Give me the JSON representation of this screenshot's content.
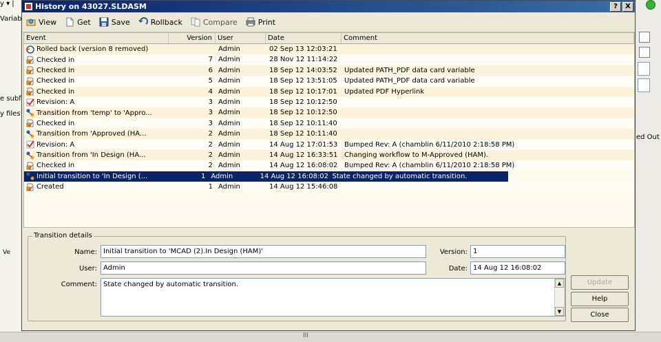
{
  "background": {
    "left_texts": [
      "y  ▾  |",
      "Variabl",
      "e subfo",
      "y files"
    ],
    "right_text": "ed Out I",
    "bottom_text": "III",
    "left_tab": "Ve"
  },
  "dialog": {
    "title": "History on 43027.SLDASM",
    "help_btn": "?",
    "close_btn": "X"
  },
  "toolbar": {
    "items": [
      {
        "label": "View",
        "icon": "view-icon",
        "enabled": true
      },
      {
        "label": "Get",
        "icon": "get-icon",
        "enabled": true
      },
      {
        "label": "Save",
        "icon": "save-icon",
        "enabled": true
      },
      {
        "label": "Rollback",
        "icon": "rollback-icon",
        "enabled": true
      },
      {
        "label": "Compare",
        "icon": "compare-icon",
        "enabled": false
      },
      {
        "label": "Print",
        "icon": "print-icon",
        "enabled": true
      }
    ]
  },
  "list": {
    "columns": [
      "Event",
      "Version",
      "User",
      "Date",
      "Comment"
    ],
    "rows": [
      {
        "event": "Rolled back (version 8 removed)",
        "icon": "rollback-event-icon",
        "version": "",
        "user": "Admin",
        "date": "02 Sep 13 12:03:21",
        "comment": ""
      },
      {
        "event": "Checked in",
        "icon": "checkin-icon",
        "version": "7",
        "user": "Admin",
        "date": "28 Nov 12 11:14:22",
        "comment": ""
      },
      {
        "event": "Checked in",
        "icon": "checkin-icon",
        "version": "6",
        "user": "Admin",
        "date": "18 Sep 12 14:03:52",
        "comment": "Updated PATH_PDF data card variable"
      },
      {
        "event": "Checked in",
        "icon": "checkin-icon",
        "version": "5",
        "user": "Admin",
        "date": "18 Sep 12 13:51:05",
        "comment": "Updated PATH_PDF data card variable"
      },
      {
        "event": "Checked in",
        "icon": "checkin-icon",
        "version": "4",
        "user": "Admin",
        "date": "18 Sep 12 10:17:01",
        "comment": "Updated PDF Hyperlink"
      },
      {
        "event": "Revision: A",
        "icon": "revision-icon",
        "version": "3",
        "user": "Admin",
        "date": "18 Sep 12 10:12:50",
        "comment": ""
      },
      {
        "event": "Transition from 'temp' to 'Appro...",
        "icon": "transition-icon",
        "version": "3",
        "user": "Admin",
        "date": "18 Sep 12 10:12:50",
        "comment": ""
      },
      {
        "event": "Checked in",
        "icon": "checkin-icon",
        "version": "3",
        "user": "Admin",
        "date": "18 Sep 12 10:11:40",
        "comment": ""
      },
      {
        "event": "Transition from 'Approved (HA...",
        "icon": "transition-icon",
        "version": "2",
        "user": "Admin",
        "date": "18 Sep 12 10:11:40",
        "comment": ""
      },
      {
        "event": "Revision: A",
        "icon": "revision-icon",
        "version": "2",
        "user": "Admin",
        "date": "14 Aug 12 17:01:53",
        "comment": "Bumped Rev: A  (chamblin 6/11/2010 2:18:58 PM)"
      },
      {
        "event": "Transition from 'In Design (HA...",
        "icon": "transition-icon",
        "version": "2",
        "user": "Admin",
        "date": "14 Aug 12 16:33:51",
        "comment": "Changing workflow to M-Approved (HAM)."
      },
      {
        "event": "Checked in",
        "icon": "checkin-icon",
        "version": "2",
        "user": "Admin",
        "date": "14 Aug 12 16:08:02",
        "comment": "Bumped Rev: A  (chamblin 6/11/2010 2:18:58 PM)"
      },
      {
        "event": "Initial transition to 'In Design (...",
        "icon": "transition-icon",
        "version": "1",
        "user": "Admin",
        "date": "14 Aug 12 16:08:02",
        "comment": "State changed by automatic transition.",
        "selected": true
      },
      {
        "event": "Created",
        "icon": "checkin-icon",
        "version": "1",
        "user": "Admin",
        "date": "14 Aug 12 15:46:08",
        "comment": ""
      }
    ]
  },
  "details": {
    "legend": "Transition details",
    "name_label": "Name:",
    "name_value": "Initial transition to 'MCAD (2).In Design (HAM)'",
    "version_label": "Version:",
    "version_value": "1",
    "user_label": "User:",
    "user_value": "Admin",
    "date_label": "Date:",
    "date_value": "14 Aug 12 16:08:02",
    "comment_label": "Comment:",
    "comment_value": "State changed by automatic transition."
  },
  "buttons": {
    "update": "Update",
    "help": "Help",
    "close": "Close"
  }
}
